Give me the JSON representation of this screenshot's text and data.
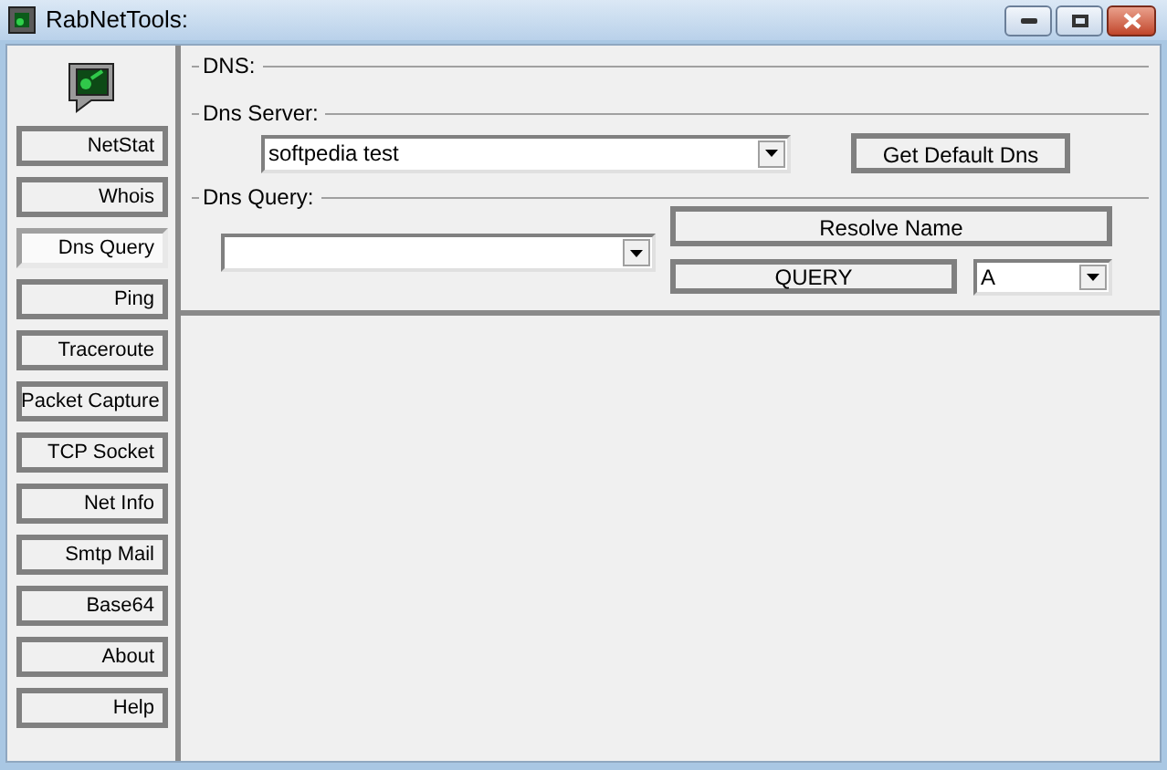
{
  "window": {
    "title": "RabNetTools:"
  },
  "sidebar": {
    "items": [
      {
        "label": "NetStat",
        "selected": false
      },
      {
        "label": "Whois",
        "selected": false
      },
      {
        "label": "Dns Query",
        "selected": true
      },
      {
        "label": "Ping",
        "selected": false
      },
      {
        "label": "Traceroute",
        "selected": false
      },
      {
        "label": "Packet Capture",
        "selected": false
      },
      {
        "label": "TCP Socket",
        "selected": false
      },
      {
        "label": "Net Info",
        "selected": false
      },
      {
        "label": "Smtp Mail",
        "selected": false
      },
      {
        "label": "Base64",
        "selected": false
      },
      {
        "label": "About",
        "selected": false
      },
      {
        "label": "Help",
        "selected": false
      }
    ]
  },
  "dns": {
    "title": "DNS:",
    "server": {
      "title": "Dns Server:",
      "value": "softpedia test",
      "button": "Get Default Dns"
    },
    "query": {
      "title": "Dns Query:",
      "resolve_button": "Resolve Name",
      "query_button": "QUERY",
      "record_type": "A"
    }
  }
}
